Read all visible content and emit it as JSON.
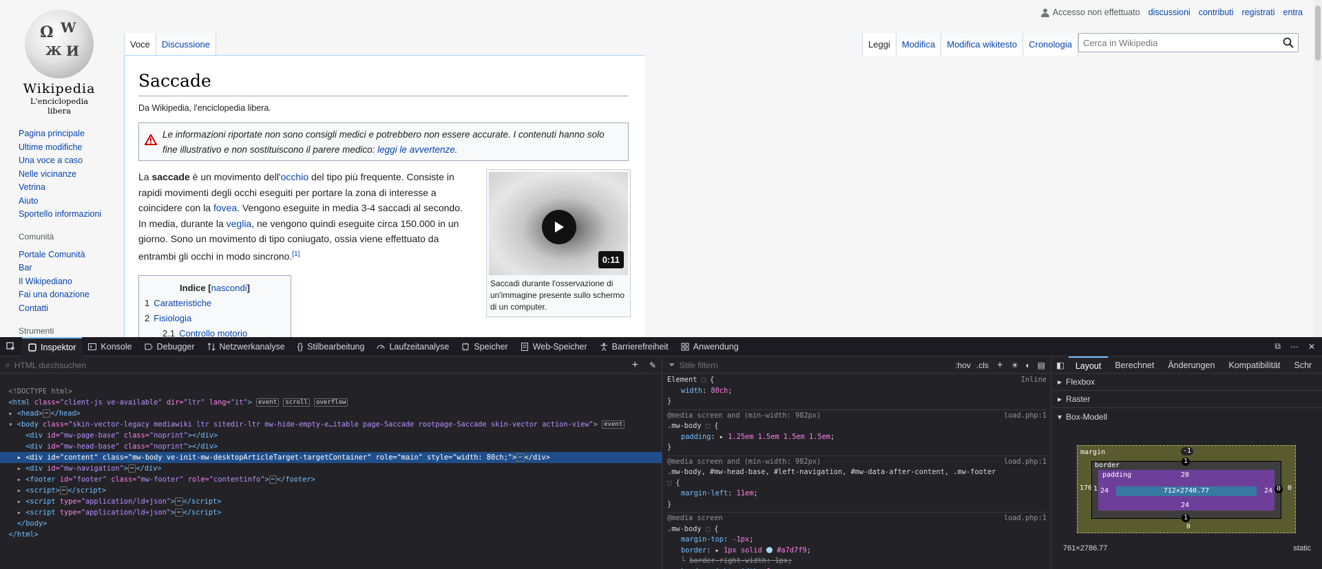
{
  "page": {
    "logo": {
      "wordmark": "Wikipedia",
      "tagline": "L'enciclopedia libera"
    },
    "nav_main": [
      "Pagina principale",
      "Ultime modifiche",
      "Una voce a caso",
      "Nelle vicinanze",
      "Vetrina",
      "Aiuto",
      "Sportello informazioni"
    ],
    "community_heading": "Comunità",
    "nav_community": [
      "Portale Comunità",
      "Bar",
      "Il Wikipediano",
      "Fai una donazione",
      "Contatti"
    ],
    "tools_heading": "Strumenti",
    "personal": {
      "anon": "Accesso non effettuato",
      "talk": "discussioni",
      "contrib": "contributi",
      "register": "registrati",
      "login": "entra"
    },
    "tabs_left": [
      "Voce",
      "Discussione"
    ],
    "tabs_right": [
      "Leggi",
      "Modifica",
      "Modifica wikitesto",
      "Cronologia"
    ],
    "search_placeholder": "Cerca in Wikipedia",
    "title": "Saccade",
    "subtitle": "Da Wikipedia, l'enciclopedia libera.",
    "notice": {
      "text": "Le informazioni riportate non sono consigli medici e potrebbero non essere accurate. I contenuti hanno solo fine illustrativo e non sostituiscono il parere medico: ",
      "link": "leggi le avvertenze"
    },
    "lead": {
      "p1": "La ",
      "bold": "saccade",
      "p2": " è un movimento dell'",
      "l1": "occhio",
      "p3": " del tipo più frequente. Consiste in rapidi movimenti degli occhi eseguiti per portare la zona di interesse a coincidere con la ",
      "l2": "fovea",
      "p4": ". Vengono eseguite in media 3-4 saccadi al secondo. In media, durante la ",
      "l3": "veglia",
      "p5": ", ne vengono quindi eseguite circa 150.000 in un giorno. Sono un movimento di tipo coniugato, ossia viene effettuato da entrambi gli occhi in modo sincrono.",
      "ref": "[1]"
    },
    "video": {
      "duration": "0:11",
      "caption": "Saccadi durante l'osservazione di un'immagine presente sullo schermo di un computer."
    },
    "toc": {
      "title": "Indice",
      "toggle_open": "[",
      "toggle": "nascondi",
      "toggle_close": "]",
      "items": [
        {
          "num": "1",
          "label": "Caratteristiche"
        },
        {
          "num": "2",
          "label": "Fisiologia"
        },
        {
          "num": "2.1",
          "label": "Controllo motorio"
        }
      ]
    }
  },
  "devtools": {
    "tabs": [
      "Inspektor",
      "Konsole",
      "Debugger",
      "Netzwerkanalyse",
      "Stilbearbeitung",
      "Laufzeitanalyse",
      "Speicher",
      "Web-Speicher",
      "Barrierefreiheit",
      "Anwendung"
    ],
    "html_search_placeholder": "HTML durchsuchen",
    "styles_filter_placeholder": "Stile filtern",
    "hov": ":hov",
    "cls": ".cls",
    "layout_tabs": [
      "Layout",
      "Berechnet",
      "Änderungen",
      "Kompatibilität",
      "Schr"
    ],
    "flexbox": "Flexbox",
    "grid": "Raster",
    "boxmodel": "Box-Modell",
    "box": {
      "margin_label": "margin",
      "border_label": "border",
      "padding_label": "padding",
      "margin_top": "-1",
      "margin_left": "176",
      "margin_right": "0",
      "margin_bottom": "0",
      "border_top": "1",
      "border_left": "1",
      "border_right": "0",
      "border_bottom": "1",
      "padding_top": "20",
      "padding_left": "24",
      "padding_right": "24",
      "padding_bottom": "24",
      "content": "712×2740.77"
    },
    "box_size": "761×2786.77",
    "position": "static"
  },
  "colors": {
    "link": "#0645ad",
    "devtools_bg": "#232327",
    "selection": "#204e8a",
    "accent": "#75bfff"
  }
}
